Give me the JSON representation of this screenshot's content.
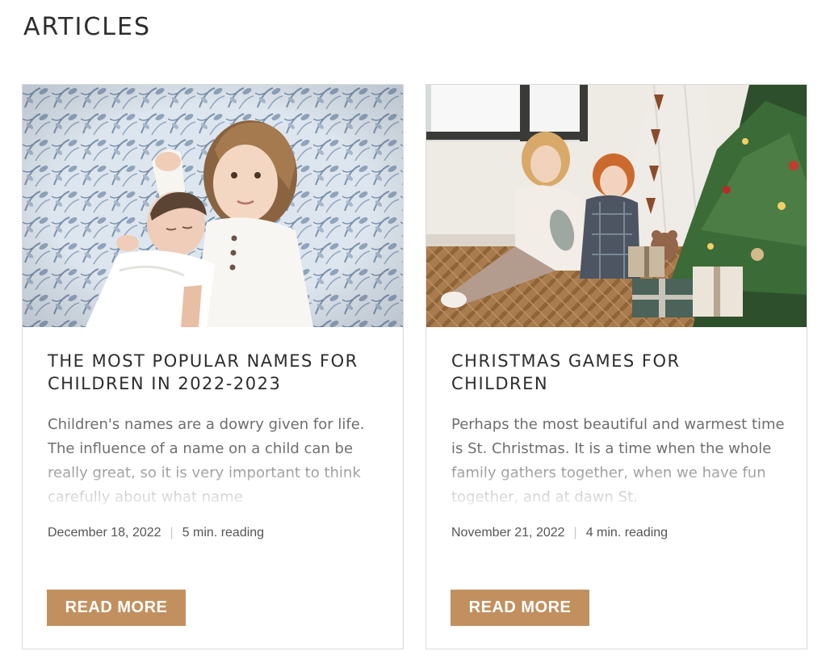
{
  "page": {
    "title": "ARTICLES"
  },
  "colors": {
    "accent": "#c2905f",
    "border": "#d9d9d9",
    "text": "#2d2d2d",
    "muted": "#6d6d6d"
  },
  "articles": [
    {
      "image": "photo: toddler girl lying next to a sleeping swaddled baby on floral bedding",
      "title": "THE MOST POPULAR NAMES FOR CHILDREN IN 2022-2023",
      "excerpt": "Children's names are a dowry given for life. The influence of a name on a child can be really great, so it is very important to think carefully about what name",
      "date": "December 18, 2022",
      "separator": "|",
      "reading": "5 min. reading",
      "button": "READ MORE"
    },
    {
      "image": "photo: two children sitting on a wooden floor beside a decorated Christmas tree and wrapped gifts",
      "title": "CHRISTMAS GAMES FOR CHILDREN",
      "excerpt": "Perhaps the most beautiful and warmest time is St. Christmas. It is a time when the whole family gathers together, when we have fun together, and at dawn St.",
      "date": "November 21, 2022",
      "separator": "|",
      "reading": "4 min. reading",
      "button": "READ MORE"
    }
  ]
}
